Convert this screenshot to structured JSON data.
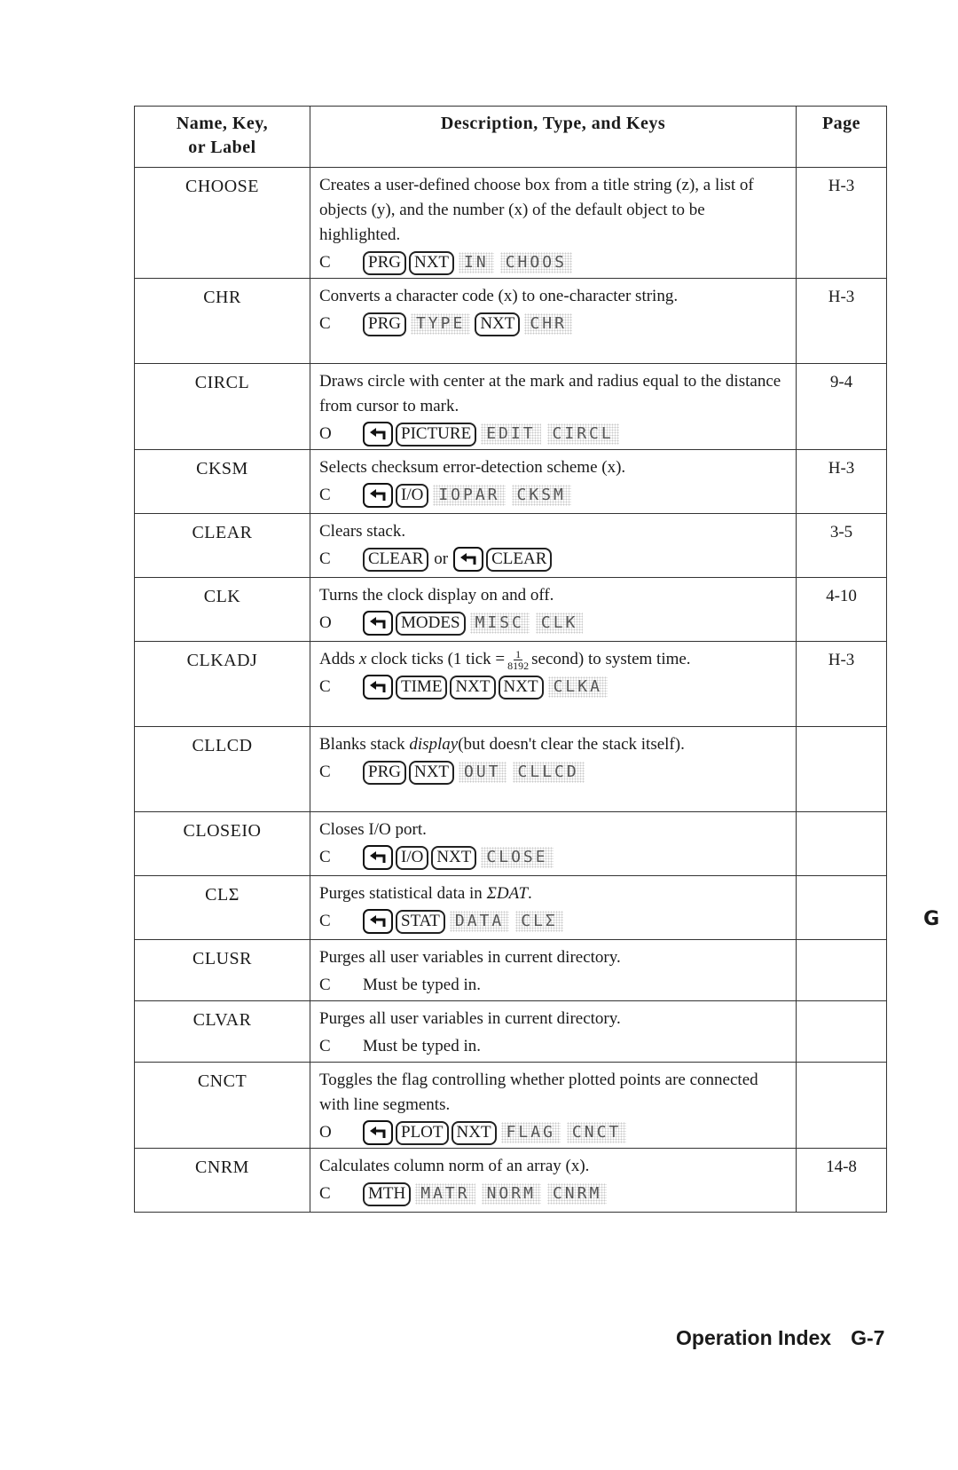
{
  "table": {
    "headers": {
      "name": "Name, Key, or Label",
      "name_line1": "Name, Key,",
      "name_line2": "or Label",
      "description": "Description, Type, and Keys",
      "page": "Page"
    },
    "rows": [
      {
        "name": "CHOOSE",
        "description": "Creates a user-defined choose box from a title string (z), a list of objects (y), and the number (x) of the default object to be highlighted.",
        "type": "C",
        "keys": [
          {
            "kind": "key",
            "label": "PRG"
          },
          {
            "kind": "key",
            "label": "NXT"
          },
          {
            "kind": "soft",
            "label": "IN"
          },
          {
            "kind": "soft",
            "label": "CHOOS"
          }
        ],
        "page": "H-3"
      },
      {
        "name": "CHR",
        "description": "Converts a character code (x) to one-character string.",
        "type": "C",
        "keys": [
          {
            "kind": "key",
            "label": "PRG"
          },
          {
            "kind": "soft",
            "label": "TYPE"
          },
          {
            "kind": "key",
            "label": "NXT"
          },
          {
            "kind": "soft",
            "label": "CHR"
          }
        ],
        "page": "H-3"
      },
      {
        "name": "CIRCL",
        "description": "Draws circle with center at the mark and radius equal to the distance from cursor to mark.",
        "type": "O",
        "keys": [
          {
            "kind": "shift",
            "label": "left-shift"
          },
          {
            "kind": "key",
            "label": "PICTURE"
          },
          {
            "kind": "soft",
            "label": "EDIT"
          },
          {
            "kind": "soft",
            "label": "CIRCL"
          }
        ],
        "page": "9-4"
      },
      {
        "name": "CKSM",
        "description": "Selects checksum error-detection scheme (x).",
        "type": "C",
        "keys": [
          {
            "kind": "shift",
            "label": "left-shift"
          },
          {
            "kind": "key",
            "label": "I/O"
          },
          {
            "kind": "soft",
            "label": "IOPAR"
          },
          {
            "kind": "soft",
            "label": "CKSM"
          }
        ],
        "page": "H-3"
      },
      {
        "name": "CLEAR",
        "description": "Clears stack.",
        "type": "C",
        "keys": [
          {
            "kind": "key",
            "label": "CLEAR"
          },
          {
            "kind": "text",
            "label": "or"
          },
          {
            "kind": "shift",
            "label": "left-shift"
          },
          {
            "kind": "key",
            "label": "CLEAR"
          }
        ],
        "page": "3-5"
      },
      {
        "name": "CLK",
        "description": "Turns the clock display on and off.",
        "type": "O",
        "keys": [
          {
            "kind": "shift",
            "label": "left-shift"
          },
          {
            "kind": "key",
            "label": "MODES"
          },
          {
            "kind": "soft",
            "label": "MISC"
          },
          {
            "kind": "soft",
            "label": "CLK"
          }
        ],
        "page": "4-10"
      },
      {
        "name": "CLKADJ",
        "description_pre": "Adds",
        "description_var": "x",
        "description_mid": "clock ticks (1 tick =",
        "fraction_num": "1",
        "fraction_den": "8192",
        "description_post": "second) to system time.",
        "type": "C",
        "keys": [
          {
            "kind": "shift",
            "label": "left-shift"
          },
          {
            "kind": "key",
            "label": "TIME"
          },
          {
            "kind": "key",
            "label": "NXT"
          },
          {
            "kind": "key",
            "label": "NXT"
          },
          {
            "kind": "soft",
            "label": "CLKA"
          }
        ],
        "page": "H-3"
      },
      {
        "name": "CLLCD",
        "description_pre": "Blanks stack",
        "description_em": "display",
        "description_post": "(but doesn't clear the stack itself).",
        "type": "C",
        "keys": [
          {
            "kind": "key",
            "label": "PRG"
          },
          {
            "kind": "key",
            "label": "NXT"
          },
          {
            "kind": "soft",
            "label": "OUT"
          },
          {
            "kind": "soft",
            "label": "CLLCD"
          }
        ],
        "page": ""
      },
      {
        "name": "CLOSEIO",
        "description": "Closes I/O port.",
        "type": "C",
        "keys": [
          {
            "kind": "shift",
            "label": "left-shift"
          },
          {
            "kind": "key",
            "label": "I/O"
          },
          {
            "kind": "key",
            "label": "NXT"
          },
          {
            "kind": "soft",
            "label": "CLOSE"
          }
        ],
        "page": ""
      },
      {
        "name": "CLΣ",
        "description_pre": "Purges statistical data in",
        "description_em": "ΣDAT",
        "description_post": ".",
        "type": "C",
        "keys": [
          {
            "kind": "shift",
            "label": "left-shift"
          },
          {
            "kind": "key",
            "label": "STAT"
          },
          {
            "kind": "soft",
            "label": "DATA"
          },
          {
            "kind": "soft",
            "label": "CLΣ"
          }
        ],
        "page": ""
      },
      {
        "name": "CLUSR",
        "description": "Purges all user variables in current directory.",
        "type": "C",
        "note": "Must be typed in.",
        "page": ""
      },
      {
        "name": "CLVAR",
        "description": "Purges all user variables in current directory.",
        "type": "C",
        "note": "Must be typed in.",
        "page": ""
      },
      {
        "name": "CNCT",
        "description": "Toggles the flag controlling whether plotted points are connected with line segments.",
        "type": "O",
        "keys": [
          {
            "kind": "shift",
            "label": "left-shift"
          },
          {
            "kind": "key",
            "label": "PLOT"
          },
          {
            "kind": "key",
            "label": "NXT"
          },
          {
            "kind": "soft",
            "label": "FLAG"
          },
          {
            "kind": "soft",
            "label": "CNCT"
          }
        ],
        "page": ""
      },
      {
        "name": "CNRM",
        "description": "Calculates column norm of an array (x).",
        "type": "C",
        "keys": [
          {
            "kind": "key",
            "label": "MTH"
          },
          {
            "kind": "soft",
            "label": "MATR"
          },
          {
            "kind": "soft",
            "label": "NORM"
          },
          {
            "kind": "soft",
            "label": "CNRM"
          }
        ],
        "page": "14-8"
      }
    ]
  },
  "side_tab": "G",
  "footer": {
    "section": "Operation Index",
    "page_number": "G-7"
  }
}
